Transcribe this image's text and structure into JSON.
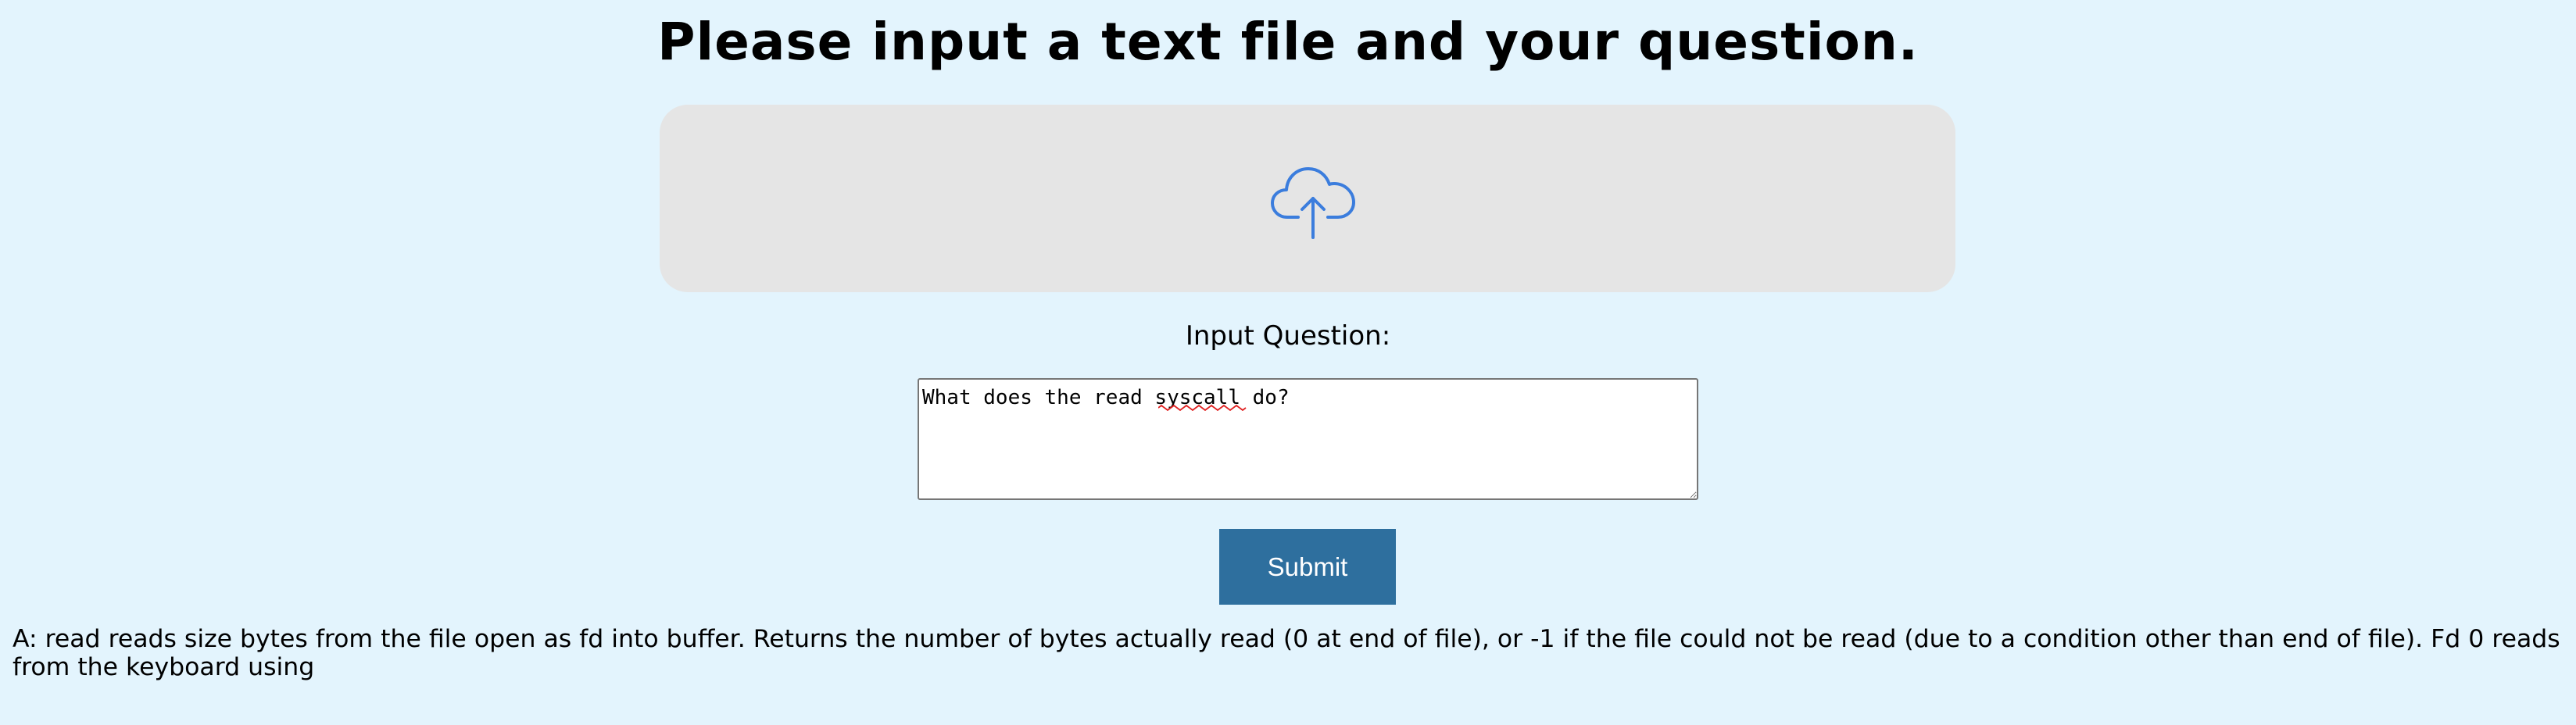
{
  "page": {
    "title": "Please input a text file and your question."
  },
  "upload": {
    "icon": "cloud-upload-icon",
    "icon_color": "#3b7ddd",
    "background": "#e5e5e5"
  },
  "question": {
    "label": "Input Question:",
    "value": "What does the read syscall do?"
  },
  "submit": {
    "label": "Submit",
    "color": "#2e6f9e"
  },
  "answer": {
    "text": "A: read reads size bytes from the file open as fd into buffer. Returns the number of bytes actually read (0 at end of file), or -1 if the file could not be read (due to a condition other than end of file). Fd 0 reads from the keyboard using"
  },
  "colors": {
    "background": "#e3f4fd"
  }
}
